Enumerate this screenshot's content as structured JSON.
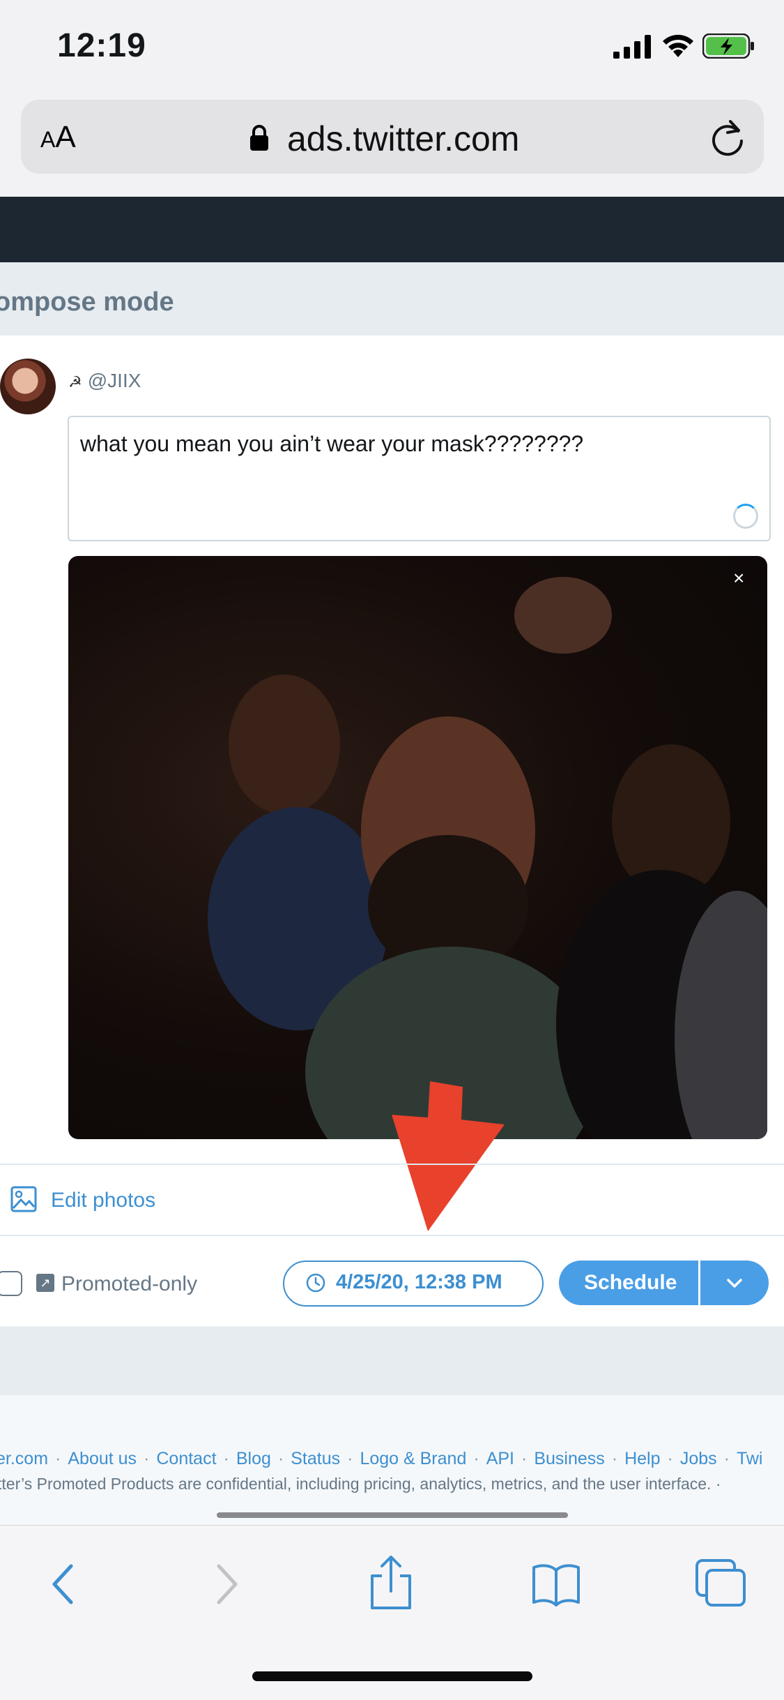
{
  "status_bar": {
    "time": "12:19"
  },
  "url_bar": {
    "text_size_label": "AA",
    "url": "ads.twitter.com"
  },
  "header": {
    "title": "ompose mode"
  },
  "compose": {
    "handle": "@JIIX",
    "tweet_text": "what you mean you ain’t wear your mask????????",
    "remove_media_label": "×"
  },
  "actions": {
    "edit_photos_label": "Edit photos",
    "promoted_only_label": "Promoted-only",
    "schedule_date": "4/25/20, 12:38 PM",
    "schedule_label": "Schedule"
  },
  "footer": {
    "links": [
      "er.com",
      "About us",
      "Contact",
      "Blog",
      "Status",
      "Logo & Brand",
      "API",
      "Business",
      "Help",
      "Jobs",
      "Twi"
    ],
    "notice": "tter’s Promoted Products are confidential, including pricing, analytics, metrics, and the user interface.  ·"
  },
  "colors": {
    "accent": "#4a9ee6",
    "nav_dark": "#1c2732",
    "annotation_arrow": "#e8412c"
  },
  "icons": [
    "signal-icon",
    "wifi-icon",
    "battery-icon",
    "lock-icon",
    "reload-icon",
    "image-icon",
    "clock-icon",
    "chevron-down-icon",
    "back-icon",
    "forward-icon",
    "share-icon",
    "bookmarks-icon",
    "tabs-icon"
  ]
}
